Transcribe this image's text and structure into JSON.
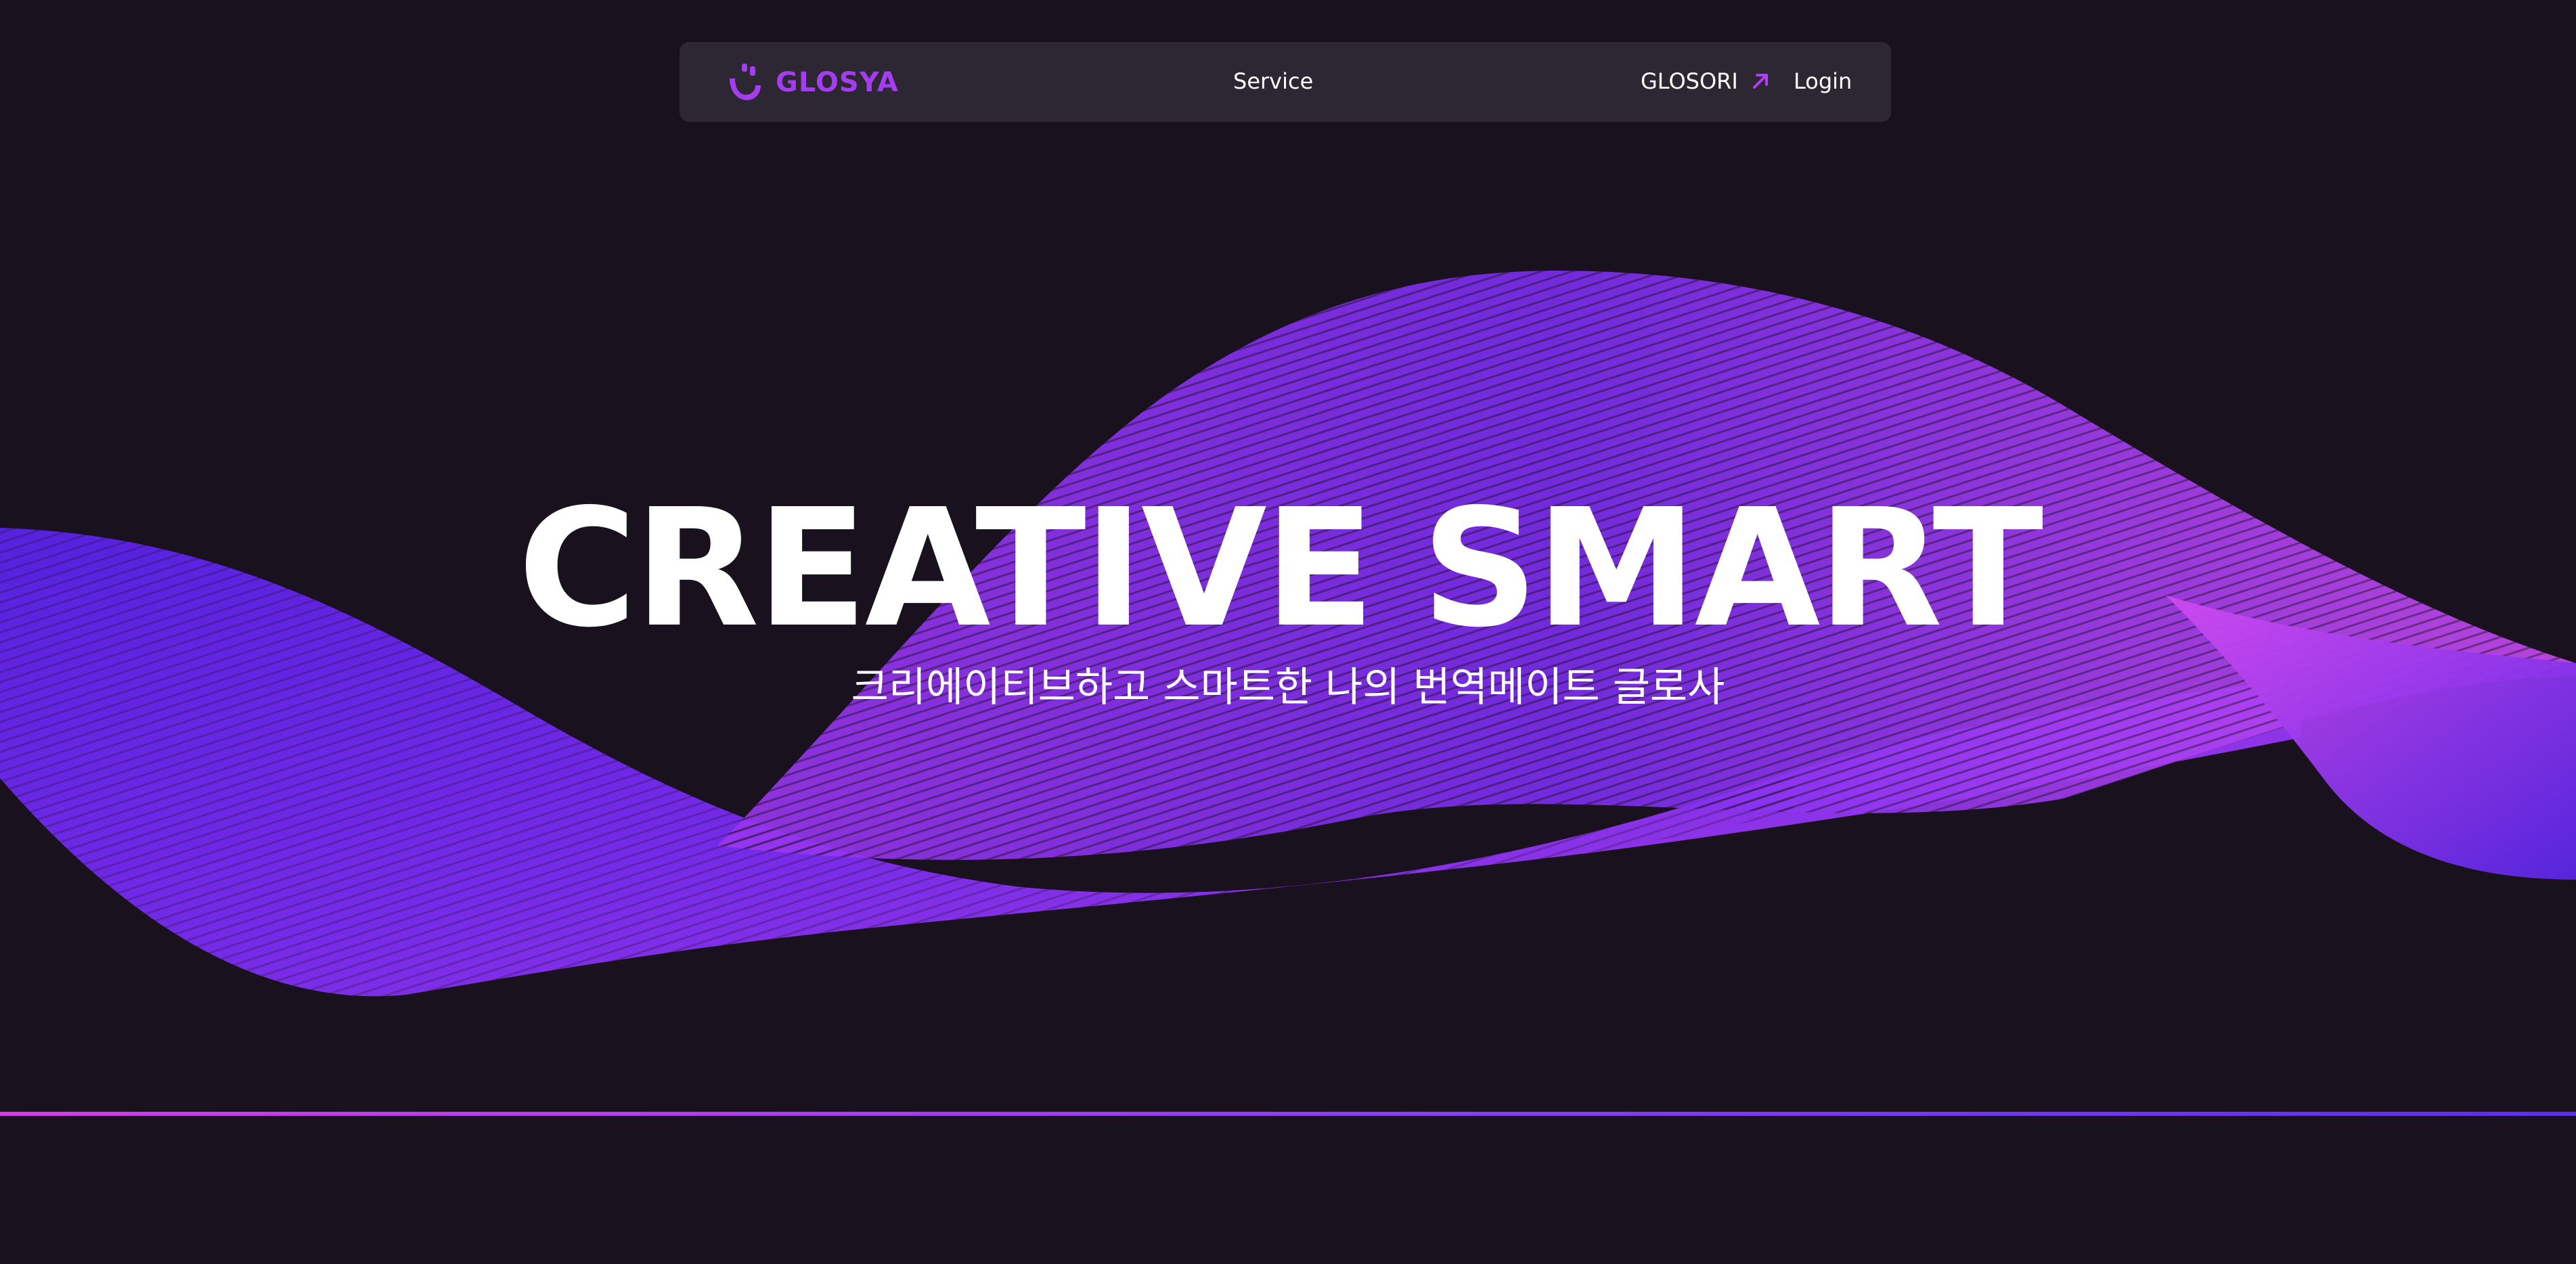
{
  "brand": {
    "logo_text": "GLOSYA",
    "logo_icon": "smile-logo-icon",
    "accent_color": "#a43cf0"
  },
  "nav": {
    "service_label": "Service",
    "glosori_label": "GLOSORI",
    "glosori_icon": "external-arrow-icon",
    "login_label": "Login"
  },
  "hero": {
    "word_left": "CREATIVE",
    "word_right": "SMART",
    "subtitle": "크리에이티브하고 스마트한 나의 번역메이트 글로사"
  },
  "colors": {
    "background": "#1a111e",
    "navbar": "#2d2633",
    "wave_purple": "#7a2cf0",
    "wave_magenta": "#c040f0",
    "divider_start": "#d23ce8",
    "divider_end": "#5b2ef0"
  }
}
